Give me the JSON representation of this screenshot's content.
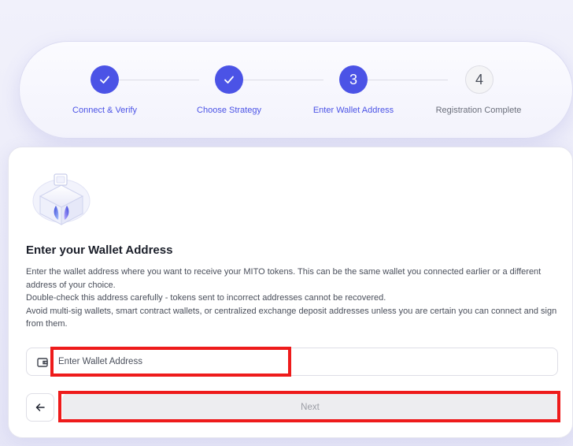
{
  "stepper": {
    "steps": [
      {
        "number": "1",
        "label": "Connect & Verify",
        "state": "done",
        "icon": "check-icon"
      },
      {
        "number": "2",
        "label": "Choose Strategy",
        "state": "done",
        "icon": "check-icon"
      },
      {
        "number": "3",
        "label": "Enter Wallet Address",
        "state": "active"
      },
      {
        "number": "4",
        "label": "Registration Complete",
        "state": "pending"
      }
    ]
  },
  "card": {
    "illustration_icon": "wallet-cube-illustration",
    "title": "Enter your Wallet Address",
    "description": [
      "Enter the wallet address where you want to receive your MITO tokens. This can be the same wallet you connected earlier or a different address of your choice.",
      "Double-check this address carefully - tokens sent to incorrect addresses cannot be recovered.",
      "Avoid multi-sig wallets, smart contract wallets, or centralized exchange deposit addresses unless you are certain you can connect and sign from them."
    ],
    "address_field": {
      "icon": "wallet-icon",
      "placeholder": "Enter Wallet Address",
      "value": ""
    },
    "back_button": {
      "icon": "arrow-left-icon"
    },
    "next_button": {
      "label": "Next",
      "disabled": true
    }
  },
  "colors": {
    "accent": "#4b53e6",
    "highlight": "#ee1b1b",
    "disabled_bg": "#ededf0"
  }
}
